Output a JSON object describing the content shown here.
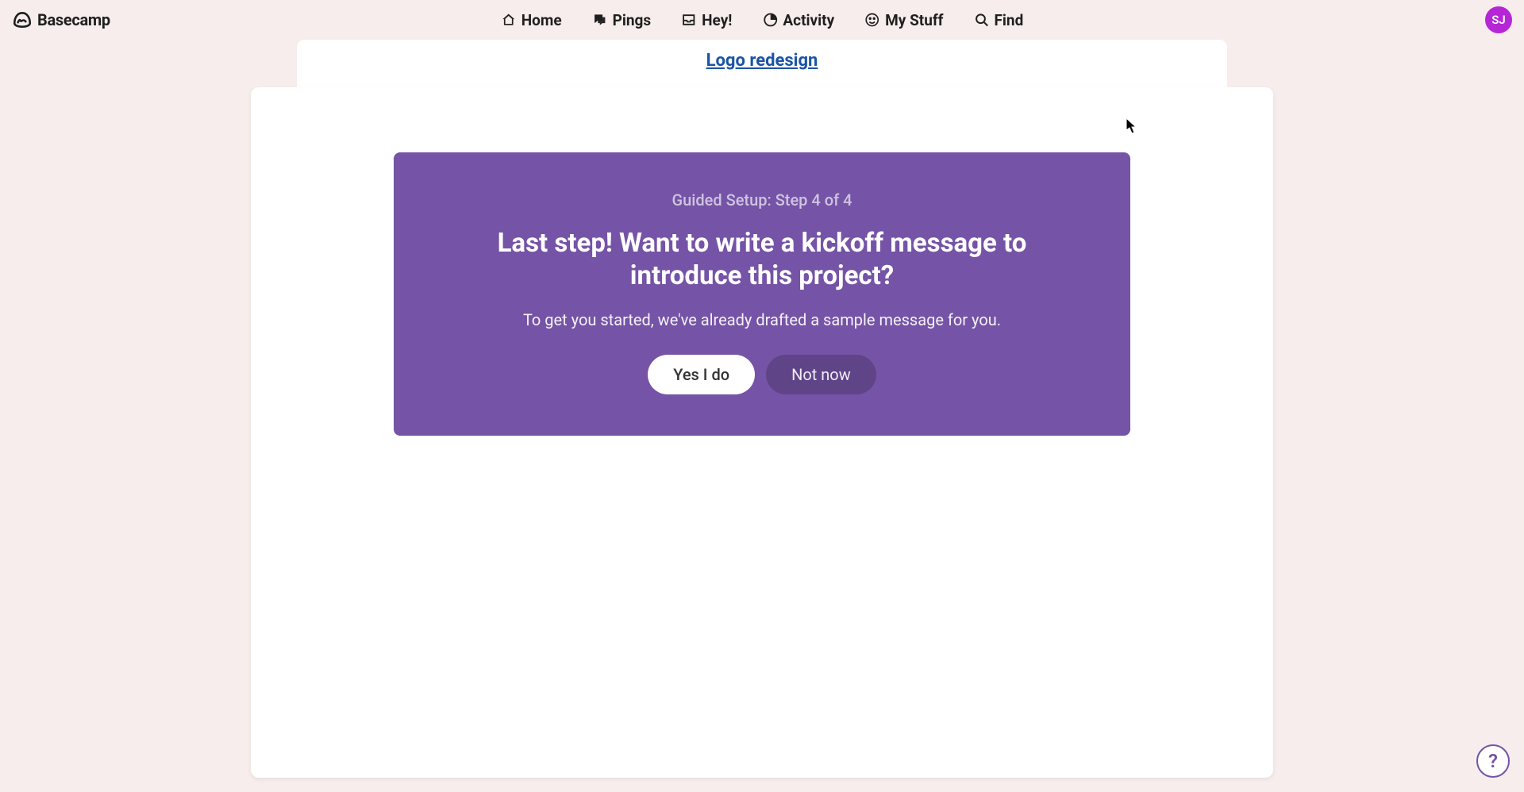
{
  "brand": {
    "name": "Basecamp"
  },
  "nav": {
    "home": "Home",
    "pings": "Pings",
    "hey": "Hey!",
    "activity": "Activity",
    "mystuff": "My Stuff",
    "find": "Find"
  },
  "avatar": {
    "initials": "SJ"
  },
  "project": {
    "title": "Logo redesign"
  },
  "panel": {
    "step": "Guided Setup: Step 4 of 4",
    "heading": "Last step! Want to write a kickoff message to introduce this project?",
    "subtext": "To get you started, we've already drafted a sample message for you.",
    "yes_label": "Yes I do",
    "no_label": "Not now"
  },
  "help": {
    "label": "?"
  }
}
